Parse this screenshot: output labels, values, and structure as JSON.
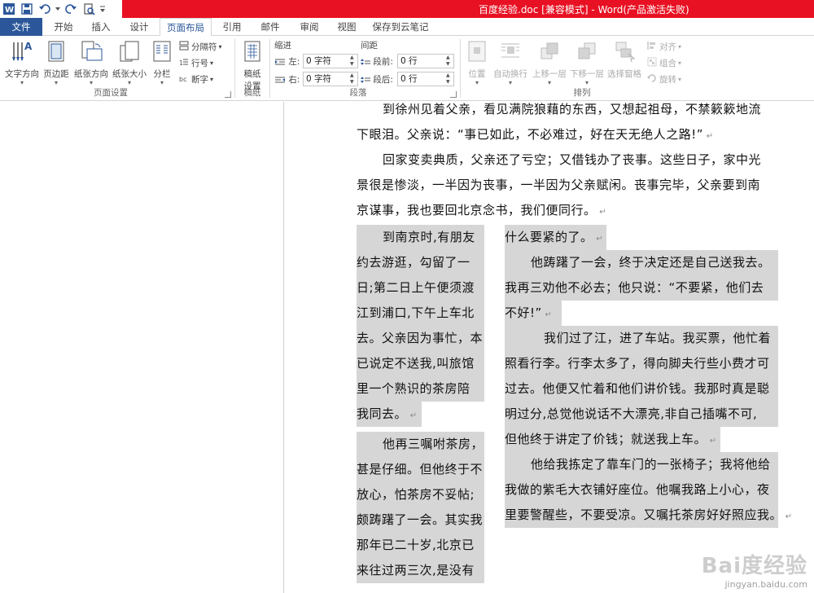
{
  "window": {
    "title": "百度经验.doc [兼容模式] - Word(产品激活失败)"
  },
  "quick_access": {
    "items": [
      "word-logo",
      "save",
      "undo",
      "redo",
      "print-preview",
      "customize"
    ]
  },
  "tabs": [
    {
      "label": "文件"
    },
    {
      "label": "开始"
    },
    {
      "label": "插入"
    },
    {
      "label": "设计"
    },
    {
      "label": "页面布局"
    },
    {
      "label": "引用"
    },
    {
      "label": "邮件"
    },
    {
      "label": "审阅"
    },
    {
      "label": "视图"
    },
    {
      "label": "保存到云笔记"
    }
  ],
  "ribbon": {
    "page_setup": {
      "group_label": "页面设置",
      "text_direction": "文字方向",
      "margins": "页边距",
      "orientation": "纸张方向",
      "size": "纸张大小",
      "columns": "分栏",
      "breaks": "分隔符",
      "line_numbers": "行号",
      "hyphenation": "断字"
    },
    "manuscript": {
      "group_label": "稿纸",
      "button": "稿纸\n设置",
      "button_line1": "稿纸",
      "button_line2": "设置"
    },
    "paragraph": {
      "group_label": "段落",
      "indent_title": "缩进",
      "spacing_title": "间距",
      "indent_left_label": "左:",
      "indent_left_value": "0 字符",
      "indent_right_label": "右:",
      "indent_right_value": "0 字符",
      "space_before_label": "段前:",
      "space_before_value": "0 行",
      "space_after_label": "段后:",
      "space_after_value": "0 行"
    },
    "arrange": {
      "group_label": "排列",
      "position": "位置",
      "wrap_text": "自动换行",
      "bring_forward": "上移一层",
      "send_backward": "下移一层",
      "selection_pane": "选择窗格",
      "align": "对齐",
      "group": "组合",
      "rotate": "旋转"
    }
  },
  "document": {
    "top_lines": [
      "到徐州见着父亲，看见满院狼藉的东西，又想起祖母，不禁簌簌地流",
      "下眼泪。父亲说：“事已如此，不必难过，好在天无绝人之路!”",
      "回家变卖典质，父亲还了亏空；又借钱办了丧事。这些日子，家中光",
      "景很是惨淡，一半因为丧事，一半因为父亲赋闲。丧事完毕，父亲要到南",
      "京谋事，我也要回北京念书，我们便同行。"
    ],
    "left_col": [
      "到南京时,有朋友",
      "约去游逛，勾留了一",
      "日;第二日上午便须渡",
      "江到浦口,下午上车北",
      "去。父亲因为事忙，本",
      "已说定不送我,叫旅馆",
      "里一个熟识的茶房陪",
      "我同去。",
      "他再三嘱咐茶房，",
      "甚是仔细。但他终于不",
      "放心，怕茶房不妥帖;",
      "颇踌躇了一会。其实我",
      "那年已二十岁,北京已",
      "来往过两三次,是没有"
    ],
    "right_col": [
      "什么要紧的了。",
      "他踌躇了一会，终于决定还是自己送我去。",
      "我再三劝他不必去；他只说：“不要紧，他们去",
      "不好!”",
      "我们过了江，进了车站。我买票，他忙着",
      "照看行李。行李太多了，得向脚夫行些小费才可",
      "过去。他便又忙着和他们讲价钱。我那时真是聪",
      "明过分,总觉他说话不大漂亮,非自己插嘴不可,",
      "但他终于讲定了价钱；就送我上车。",
      "他给我拣定了靠车门的一张椅子；我将他给",
      "我做的紫毛大衣铺好座位。他嘱我路上小心，夜",
      "里要警醒些，不要受凉。又嘱托茶房好好照应我。"
    ]
  },
  "watermark": {
    "line1": "Bai度经验",
    "line2": "jingyan.baidu.com"
  }
}
